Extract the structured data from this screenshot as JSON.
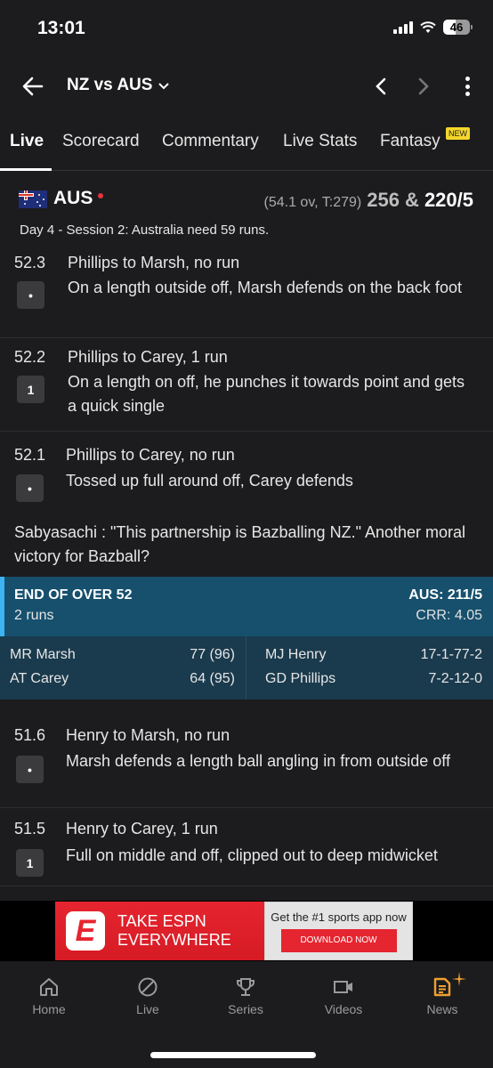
{
  "status_bar": {
    "time": "13:01",
    "battery": "46"
  },
  "topbar": {
    "title": "NZ vs AUS"
  },
  "tabs": [
    {
      "label": "Live",
      "active": true
    },
    {
      "label": "Scorecard"
    },
    {
      "label": "Commentary"
    },
    {
      "label": "Live Stats"
    },
    {
      "label": "Fantasy",
      "badge": "NEW"
    }
  ],
  "score": {
    "team": "AUS",
    "meta": "(54.1 ov, T:279)",
    "first_innings": "256 &",
    "current": "220/5",
    "status": "Day 4 - Session 2: Australia need 59 runs."
  },
  "balls_a": [
    {
      "over": "52.3",
      "title": "Phillips to Marsh, no run",
      "badge": "•",
      "desc": "On a length outside off, Marsh defends on the back foot"
    },
    {
      "over": "52.2",
      "title": "Phillips to Carey, 1 run",
      "badge": "1",
      "desc": "On a length on off, he punches it towards point and gets a quick single"
    },
    {
      "over": "52.1",
      "title": "Phillips to Carey, no run",
      "badge": "•",
      "desc": "Tossed up full around off, Carey defends"
    }
  ],
  "comment": "Sabyasachi : \"This partnership is Bazballing NZ.\" Another moral victory for Bazball?",
  "end_of_over": {
    "title": "END OF OVER 52",
    "runs": "2 runs",
    "score": "AUS: 211/5",
    "crr": "CRR: 4.05",
    "batters": [
      {
        "name": "MR Marsh",
        "stat": "77 (96)"
      },
      {
        "name": "AT Carey",
        "stat": "64 (95)"
      }
    ],
    "bowlers": [
      {
        "name": "MJ Henry",
        "stat": "17-1-77-2"
      },
      {
        "name": "GD Phillips",
        "stat": "7-2-12-0"
      }
    ]
  },
  "balls_b": [
    {
      "over": "51.6",
      "title": "Henry to Marsh, no run",
      "badge": "•",
      "desc": "Marsh defends a length ball angling in from outside off"
    },
    {
      "over": "51.5",
      "title": "Henry to Carey, 1 run",
      "badge": "1",
      "desc": "Full on middle and off, clipped out to deep midwicket"
    }
  ],
  "ad": {
    "headline_1": "TAKE ESPN",
    "headline_2": "EVERYWHERE",
    "tagline": "Get the #1 sports app now",
    "cta": "DOWNLOAD NOW"
  },
  "bottom_nav": [
    {
      "label": "Home",
      "icon": "home-icon"
    },
    {
      "label": "Live",
      "icon": "ball-icon"
    },
    {
      "label": "Series",
      "icon": "trophy-icon"
    },
    {
      "label": "Videos",
      "icon": "video-icon"
    },
    {
      "label": "News",
      "icon": "news-icon"
    }
  ],
  "colors": {
    "accent_news": "#f0a030",
    "eoo_header": "#16506d",
    "eoo_accent": "#3db3f2",
    "live_dot": "#e3343f",
    "new_badge": "#f3d62a"
  }
}
